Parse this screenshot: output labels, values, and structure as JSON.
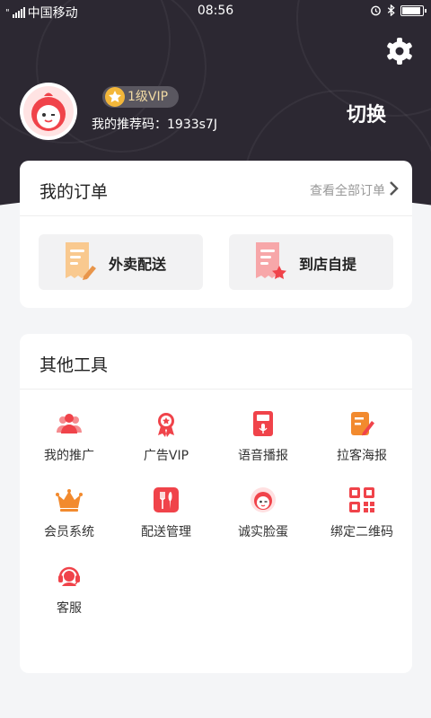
{
  "status_bar": {
    "carrier": "中国移动",
    "time": "08:56"
  },
  "profile": {
    "vip_level": "1级VIP",
    "referral_code": "我的推荐码：1933s7J",
    "switch_label": "切换"
  },
  "orders": {
    "title": "我的订单",
    "view_all": "查看全部订单",
    "buttons": [
      {
        "label": "外卖配送",
        "icon": "delivery-receipt-icon"
      },
      {
        "label": "到店自提",
        "icon": "pickup-receipt-icon"
      }
    ]
  },
  "tools": {
    "title": "其他工具",
    "items": [
      {
        "label": "我的推广",
        "icon": "people-icon"
      },
      {
        "label": "广告VIP",
        "icon": "medal-icon"
      },
      {
        "label": "语音播报",
        "icon": "microphone-icon"
      },
      {
        "label": "拉客海报",
        "icon": "poster-icon"
      },
      {
        "label": "会员系统",
        "icon": "crown-icon"
      },
      {
        "label": "配送管理",
        "icon": "cutlery-icon"
      },
      {
        "label": "诚实脸蛋",
        "icon": "face-icon"
      },
      {
        "label": "绑定二维码",
        "icon": "qrcode-icon"
      },
      {
        "label": "客服",
        "icon": "headset-icon"
      }
    ]
  },
  "colors": {
    "header_bg": "#2c2832",
    "accent_red": "#f0434a",
    "vip_gold": "#f0d9a3"
  }
}
